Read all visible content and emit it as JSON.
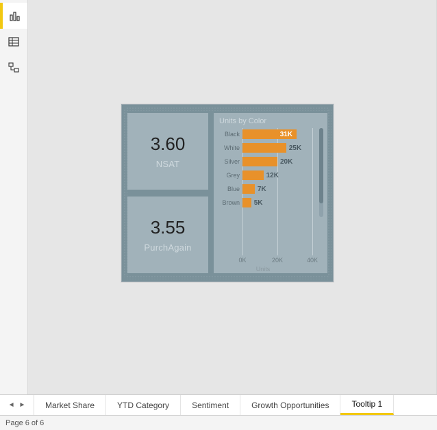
{
  "leftbar": {
    "items": [
      {
        "name": "report-view-button",
        "icon": "bar-chart-icon",
        "active": true
      },
      {
        "name": "data-view-button",
        "icon": "table-icon",
        "active": false
      },
      {
        "name": "model-view-button",
        "icon": "model-icon",
        "active": false
      }
    ]
  },
  "kpis": [
    {
      "value": "3.60",
      "label": "NSAT"
    },
    {
      "value": "3.55",
      "label": "PurchAgain"
    }
  ],
  "chart_data": {
    "type": "bar",
    "orientation": "horizontal",
    "title": "Units by Color",
    "xlabel": "Units",
    "categories": [
      "Black",
      "White",
      "Silver",
      "Grey",
      "Blue",
      "Brown"
    ],
    "values": [
      31000,
      25000,
      20000,
      12000,
      7000,
      5000
    ],
    "data_labels": [
      "31K",
      "25K",
      "20K",
      "12K",
      "7K",
      "5K"
    ],
    "xlim": [
      0,
      40000
    ],
    "xticks": [
      0,
      20000,
      40000
    ],
    "xtick_labels": [
      "0K",
      "20K",
      "40K"
    ],
    "bar_color": "#e8912a"
  },
  "tabs": {
    "items": [
      {
        "label": "Market Share",
        "active": false
      },
      {
        "label": "YTD Category",
        "active": false
      },
      {
        "label": "Sentiment",
        "active": false
      },
      {
        "label": "Growth Opportunities",
        "active": false
      },
      {
        "label": "Tooltip 1",
        "active": true
      }
    ]
  },
  "status": {
    "page_text": "Page 6 of 6"
  }
}
